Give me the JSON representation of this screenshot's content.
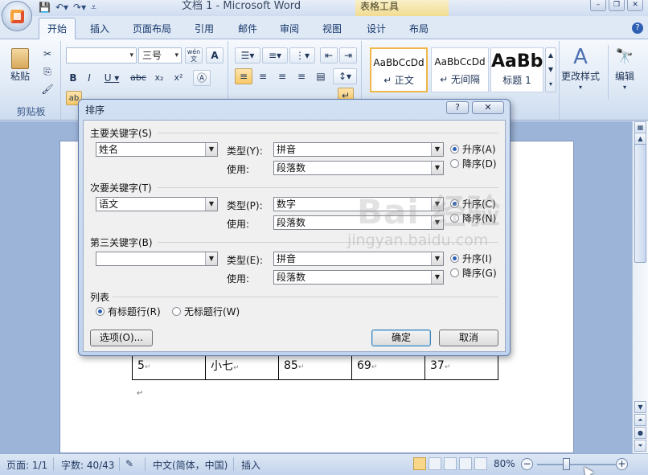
{
  "title_bar": {
    "window_title": "文档 1 - Microsoft Word",
    "context_tool_title": "表格工具",
    "qat": [
      "save-icon",
      "undo-icon",
      "redo-icon",
      "customize-icon"
    ],
    "window_buttons": [
      "minimize-icon",
      "restore-icon",
      "close-icon"
    ]
  },
  "tabs": [
    {
      "label": "开始",
      "active": true
    },
    {
      "label": "插入"
    },
    {
      "label": "页面布局"
    },
    {
      "label": "引用"
    },
    {
      "label": "邮件"
    },
    {
      "label": "审阅"
    },
    {
      "label": "视图"
    },
    {
      "label": "设计"
    },
    {
      "label": "布局"
    }
  ],
  "ribbon": {
    "clipboard": {
      "paste_label": "粘贴",
      "group_label": "剪贴板"
    },
    "font": {
      "font_size": "三号",
      "wen_label": "wén"
    },
    "styles": {
      "tiles": [
        {
          "sample": "AaBbCcDd",
          "name": "↵ 正文",
          "selected": true
        },
        {
          "sample": "AaBbCcDd",
          "name": "↵ 无间隔"
        },
        {
          "sample": "AaBb",
          "name": "标题 1"
        }
      ],
      "change_styles_label": "更改样式"
    },
    "editing": {
      "label": "编辑"
    }
  },
  "document": {
    "table_row": [
      "5",
      "小七",
      "85",
      "69",
      "37"
    ]
  },
  "dialog": {
    "title": "排序",
    "help_button": "?",
    "close_button": "✕",
    "primary_key": {
      "label": "主要关键字(S)",
      "field": "姓名",
      "type_label": "类型(Y):",
      "type": "拼音",
      "use_label": "使用:",
      "use": "段落数",
      "asc": "升序(A)",
      "desc": "降序(D)",
      "order": "asc"
    },
    "secondary_key": {
      "label": "次要关键字(T)",
      "field": "语文",
      "type_label": "类型(P):",
      "type": "数字",
      "use_label": "使用:",
      "use": "段落数",
      "asc": "升序(C)",
      "desc": "降序(N)",
      "order": "asc"
    },
    "third_key": {
      "label": "第三关键字(B)",
      "field": "",
      "type_label": "类型(E):",
      "type": "拼音",
      "use_label": "使用:",
      "use": "段落数",
      "asc": "升序(I)",
      "desc": "降序(G)",
      "order": "asc"
    },
    "list": {
      "label": "列表",
      "with_header": "有标题行(R)",
      "no_header": "无标题行(W)",
      "selected": "with_header"
    },
    "options_button": "选项(O)...",
    "ok_button": "确定",
    "cancel_button": "取消"
  },
  "status_bar": {
    "page": "页面: 1/1",
    "words": "字数: 40/43",
    "language": "中文(简体，中国)",
    "mode": "插入",
    "zoom": "80%",
    "zoom_level": 0.8
  },
  "watermark": {
    "text": "Bai 经验",
    "url": "jingyan.baidu.com"
  }
}
